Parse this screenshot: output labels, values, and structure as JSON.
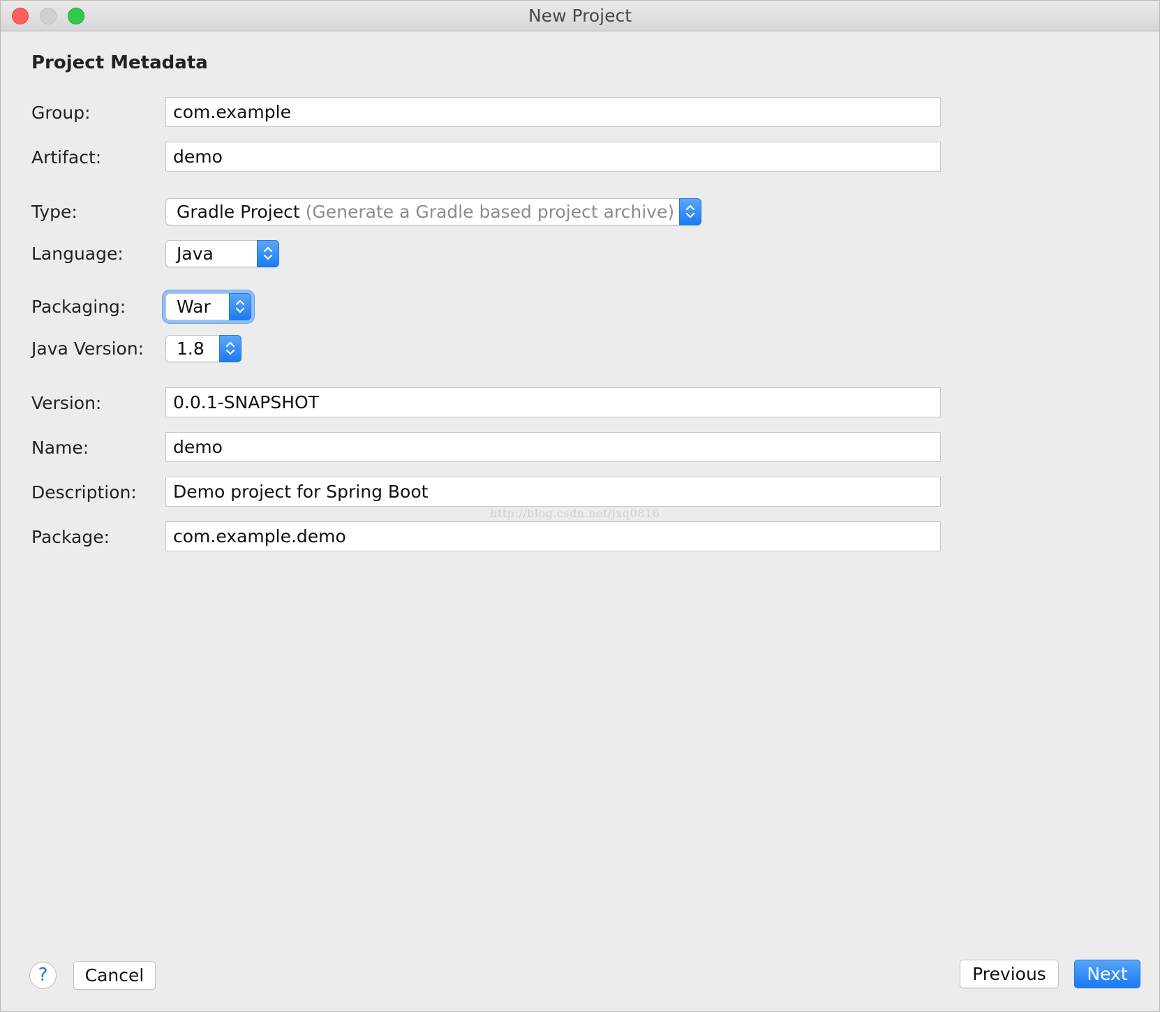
{
  "window": {
    "title": "New Project"
  },
  "section": {
    "title": "Project Metadata"
  },
  "fields": {
    "group": {
      "label": "Group:",
      "value": "com.example"
    },
    "artifact": {
      "label": "Artifact:",
      "value": "demo"
    },
    "type": {
      "label": "Type:",
      "value": "Gradle Project",
      "hint": "(Generate a Gradle based project archive)"
    },
    "language": {
      "label": "Language:",
      "value": "Java"
    },
    "packaging": {
      "label": "Packaging:",
      "value": "War"
    },
    "java_version": {
      "label": "Java Version:",
      "value": "1.8"
    },
    "version": {
      "label": "Version:",
      "value": "0.0.1-SNAPSHOT"
    },
    "name": {
      "label": "Name:",
      "value": "demo"
    },
    "description": {
      "label": "Description:",
      "value": "Demo project for Spring Boot"
    },
    "package": {
      "label": "Package:",
      "value": "com.example.demo"
    }
  },
  "watermark": "http://blog.csdn.net/jxq0816",
  "footer": {
    "help_label": "?",
    "cancel_label": "Cancel",
    "previous_label": "Previous",
    "next_label": "Next"
  },
  "icons": {
    "stepper": "up-down-chevron-icon",
    "help": "help-icon"
  },
  "colors": {
    "accent": "#1a7af1",
    "focus_ring": "#91bff7",
    "close": "#fc605c",
    "maximize": "#34c84a",
    "minimize_inactive": "#d0d0d0"
  }
}
